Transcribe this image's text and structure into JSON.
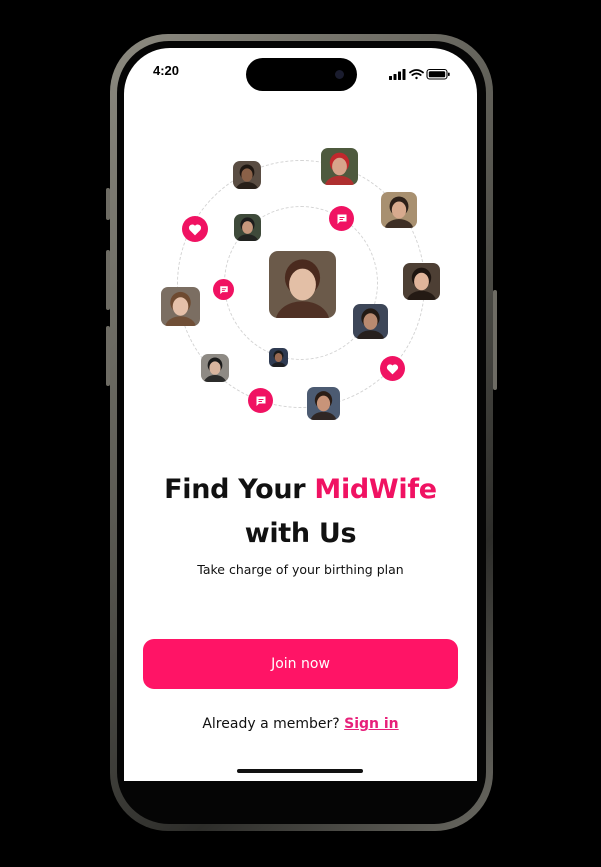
{
  "status_bar": {
    "time": "4:20"
  },
  "orbit": {
    "avatars": [
      {
        "name": "avatar-center",
        "bg": "#6b5a4a",
        "skin": "#e3bfa6",
        "hair": "#4a2a1e"
      },
      {
        "name": "avatar-top-left",
        "bg": "#5a4d43",
        "skin": "#8a6148",
        "hair": "#1f1712"
      },
      {
        "name": "avatar-top",
        "bg": "#4e5a3e",
        "skin": "#d7a48b",
        "hair": "#c1282d"
      },
      {
        "name": "avatar-top-right",
        "bg": "#a89070",
        "skin": "#d8aa8e",
        "hair": "#2b1f18"
      },
      {
        "name": "avatar-inner-left",
        "bg": "#3e4a3a",
        "skin": "#c6977c",
        "hair": "#1c1c1c"
      },
      {
        "name": "avatar-right",
        "bg": "#4d3f34",
        "skin": "#e0b49a",
        "hair": "#1d140f"
      },
      {
        "name": "avatar-left",
        "bg": "#7b6e62",
        "skin": "#e5c0a9",
        "hair": "#6e4a30"
      },
      {
        "name": "avatar-inner-right",
        "bg": "#3d4658",
        "skin": "#b98a70",
        "hair": "#231a14"
      },
      {
        "name": "avatar-inner-bottom",
        "bg": "#2f3b52",
        "skin": "#9a6a52",
        "hair": "#1a1a1a"
      },
      {
        "name": "avatar-bottom-left",
        "bg": "#8e8a84",
        "skin": "#d9b59e",
        "hair": "#1b1b1b"
      },
      {
        "name": "avatar-bottom",
        "bg": "#4c5b72",
        "skin": "#c89479",
        "hair": "#2a1d16"
      }
    ],
    "accent_color": "#f01262"
  },
  "hero": {
    "title_part1": "Find Your ",
    "title_accent": "MidWife",
    "title_part2": "with Us",
    "subtitle": "Take charge of your birthing plan"
  },
  "actions": {
    "join_label": "Join now",
    "member_prompt": "Already a member?",
    "signin_label": "Sign in"
  }
}
